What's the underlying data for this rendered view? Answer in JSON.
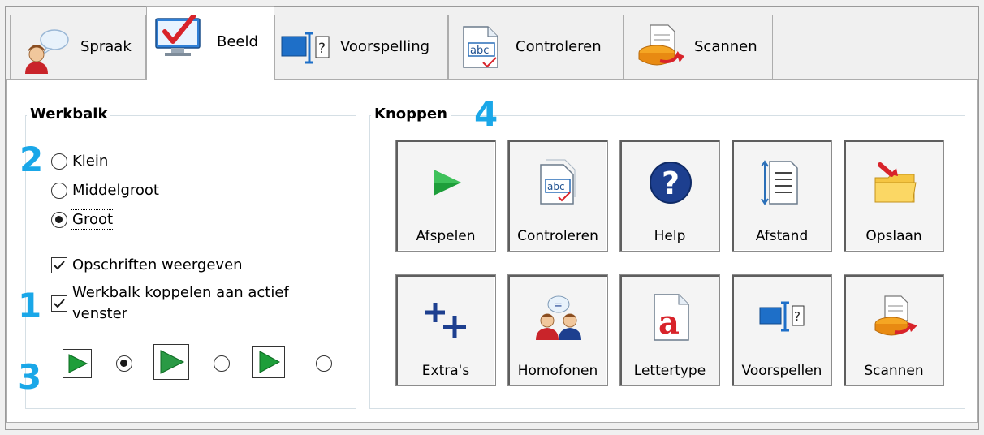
{
  "tabs": [
    {
      "label": "Spraak",
      "icon": "speaker-person-icon"
    },
    {
      "label": "Beeld",
      "icon": "monitor-check-icon"
    },
    {
      "label": "Voorspelling",
      "icon": "text-cursor-icon"
    },
    {
      "label": "Controleren",
      "icon": "abc-check-icon"
    },
    {
      "label": "Scannen",
      "icon": "scanner-icon"
    }
  ],
  "active_tab": "Beeld",
  "werkbalk": {
    "title": "Werkbalk",
    "sizes": [
      {
        "label": "Klein",
        "selected": false
      },
      {
        "label": "Middelgroot",
        "selected": false
      },
      {
        "label": "Groot",
        "selected": true
      }
    ],
    "show_captions": {
      "label": "Opschriften weergeven",
      "checked": true
    },
    "attach_toolbar": {
      "label": "Werkbalk koppelen aan actief venster",
      "checked": true
    },
    "preview_selected": 0
  },
  "knoppen": {
    "title": "Knoppen",
    "buttons": [
      {
        "label": "Afspelen",
        "icon": "play-icon"
      },
      {
        "label": "Controleren",
        "icon": "abc-check-icon"
      },
      {
        "label": "Help",
        "icon": "help-icon"
      },
      {
        "label": "Afstand",
        "icon": "line-spacing-icon"
      },
      {
        "label": "Opslaan",
        "icon": "save-folder-icon"
      },
      {
        "label": "Extra's",
        "icon": "extras-plus-icon"
      },
      {
        "label": "Homofonen",
        "icon": "homophones-icon"
      },
      {
        "label": "Lettertype",
        "icon": "font-a-icon"
      },
      {
        "label": "Voorspellen",
        "icon": "prediction-icon"
      },
      {
        "label": "Scannen",
        "icon": "scanner-icon"
      }
    ]
  },
  "annotations": [
    "1",
    "2",
    "3",
    "4"
  ],
  "colors": {
    "annotation": "#1aa7e8",
    "play_green": "#1e9e3a",
    "accent_red": "#d8232a",
    "help_blue": "#1d3f8f"
  }
}
